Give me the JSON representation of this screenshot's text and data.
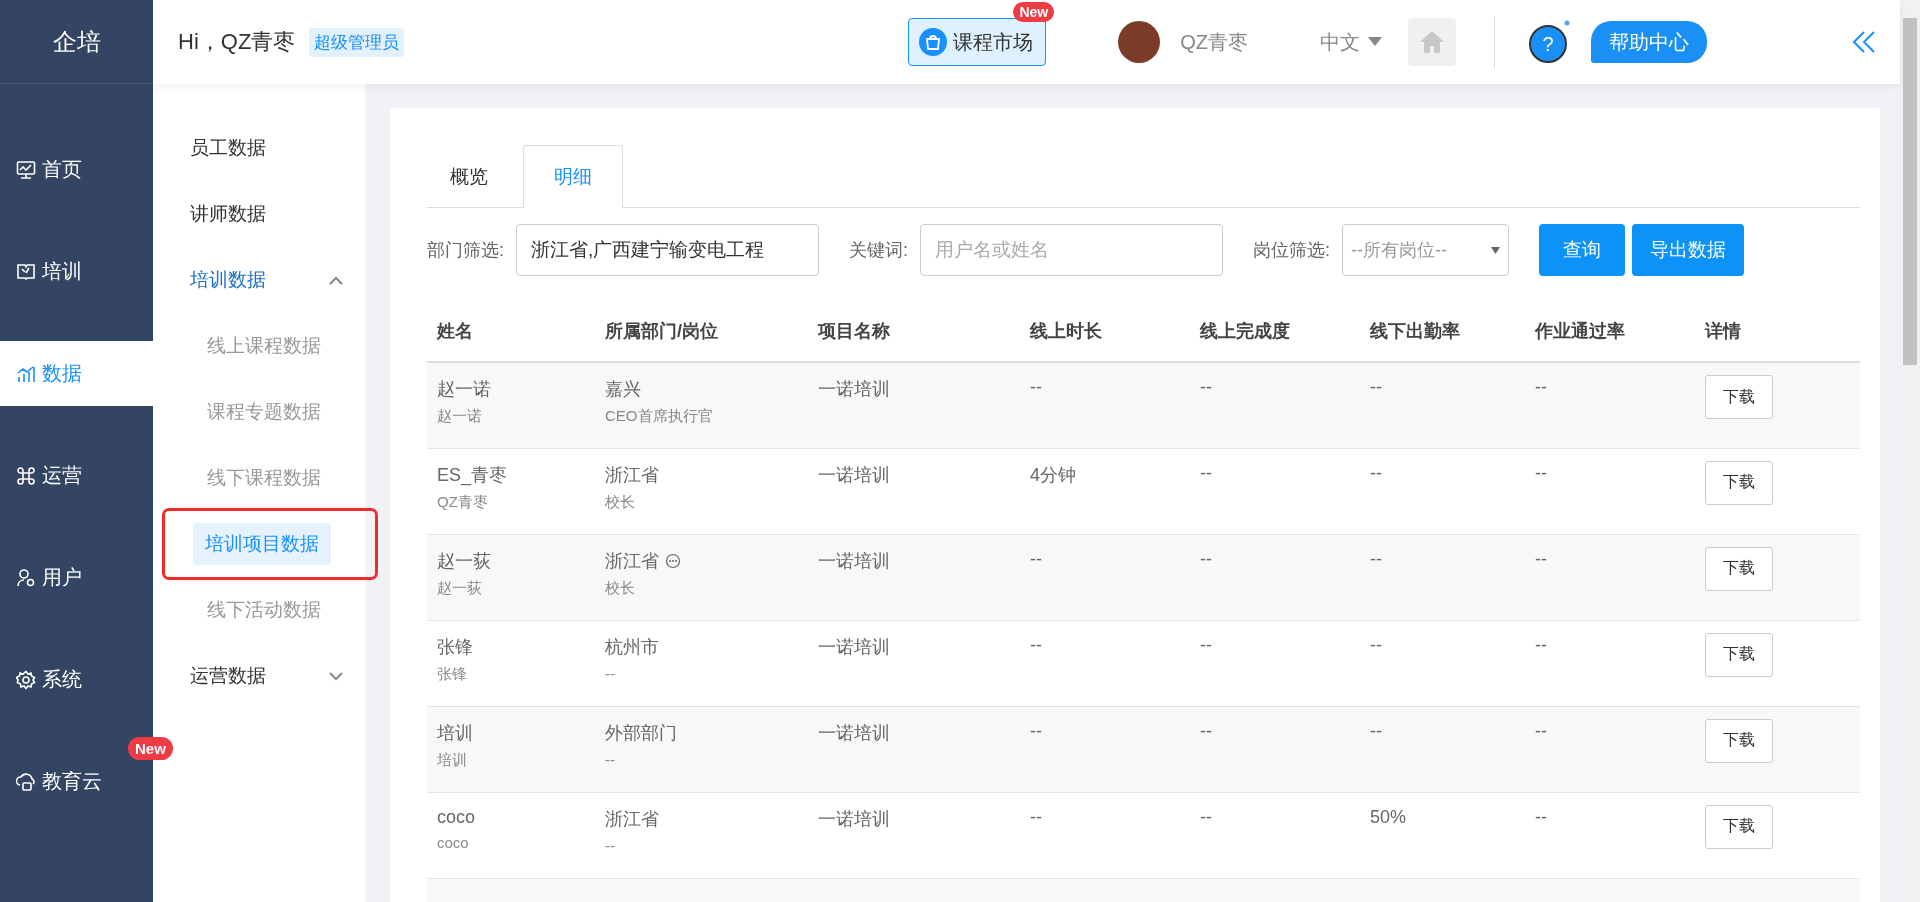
{
  "sidebar": {
    "logo": "企培",
    "items": [
      {
        "label": "首页",
        "selected": false
      },
      {
        "label": "培训",
        "selected": false
      },
      {
        "label": "数据",
        "selected": true
      },
      {
        "label": "运营",
        "selected": false
      },
      {
        "label": "用户",
        "selected": false
      },
      {
        "label": "系统",
        "selected": false
      },
      {
        "label": "教育云",
        "selected": false,
        "badge": "New"
      }
    ]
  },
  "header": {
    "greeting": "Hi，QZ青枣",
    "role_badge": "超级管理员",
    "course_market": {
      "label": "课程市场",
      "badge": "New"
    },
    "user_name": "QZ青枣",
    "language": "中文",
    "help_icon": "?",
    "help": "帮助中心"
  },
  "submenu": {
    "items": [
      {
        "kind": "leaf",
        "label": "员工数据"
      },
      {
        "kind": "leaf",
        "label": "讲师数据"
      },
      {
        "kind": "group",
        "label": "培训数据",
        "expanded": true,
        "children": [
          {
            "label": "线上课程数据",
            "selected": false
          },
          {
            "label": "课程专题数据",
            "selected": false
          },
          {
            "label": "线下课程数据",
            "selected": false
          },
          {
            "label": "培训项目数据",
            "selected": true
          },
          {
            "label": "线下活动数据",
            "selected": false
          }
        ]
      },
      {
        "kind": "group",
        "label": "运营数据",
        "expanded": false
      }
    ]
  },
  "tabs": [
    {
      "label": "概览",
      "selected": false
    },
    {
      "label": "明细",
      "selected": true
    }
  ],
  "filters": {
    "department_label": "部门筛选:",
    "department_value": "浙江省,广西建宁输变电工程",
    "keyword_label": "关键词:",
    "keyword_placeholder": "用户名或姓名",
    "position_label": "岗位筛选:",
    "position_value": "--所有岗位--"
  },
  "buttons": [
    "查询",
    "导出数据"
  ],
  "table": {
    "columns": [
      "姓名",
      "所属部门/岗位",
      "项目名称",
      "线上时长",
      "线上完成度",
      "线下出勤率",
      "作业通过率",
      "详情"
    ],
    "rows": [
      {
        "name": "赵一诺",
        "account": "赵一诺",
        "department": "嘉兴",
        "position": "CEO首席执行官",
        "more_icon": false,
        "project": "一诺培训",
        "online_duration": "--",
        "online_completion": "--",
        "offline_attendance": "--",
        "homework_pass_rate": "--",
        "action": "下载"
      },
      {
        "name": "ES_青枣",
        "account": "QZ青枣",
        "department": "浙江省",
        "position": "校长",
        "more_icon": false,
        "project": "一诺培训",
        "online_duration": "4分钟",
        "online_completion": "--",
        "offline_attendance": "--",
        "homework_pass_rate": "--",
        "action": "下载"
      },
      {
        "name": "赵一荻",
        "account": "赵一荻",
        "department": "浙江省",
        "position": "校长",
        "more_icon": true,
        "project": "一诺培训",
        "online_duration": "--",
        "online_completion": "--",
        "offline_attendance": "--",
        "homework_pass_rate": "--",
        "action": "下载"
      },
      {
        "name": "张锋",
        "account": "张锋",
        "department": "杭州市",
        "position": "--",
        "more_icon": false,
        "project": "一诺培训",
        "online_duration": "--",
        "online_completion": "--",
        "offline_attendance": "--",
        "homework_pass_rate": "--",
        "action": "下载"
      },
      {
        "name": "培训",
        "account": "培训",
        "department": "外部部门",
        "position": "--",
        "more_icon": false,
        "project": "一诺培训",
        "online_duration": "--",
        "online_completion": "--",
        "offline_attendance": "--",
        "homework_pass_rate": "--",
        "action": "下载"
      },
      {
        "name": "coco",
        "account": "coco",
        "department": "浙江省",
        "position": "--",
        "more_icon": false,
        "project": "一诺培训",
        "online_duration": "--",
        "online_completion": "--",
        "offline_attendance": "50%",
        "homework_pass_rate": "--",
        "action": "下载"
      }
    ]
  }
}
